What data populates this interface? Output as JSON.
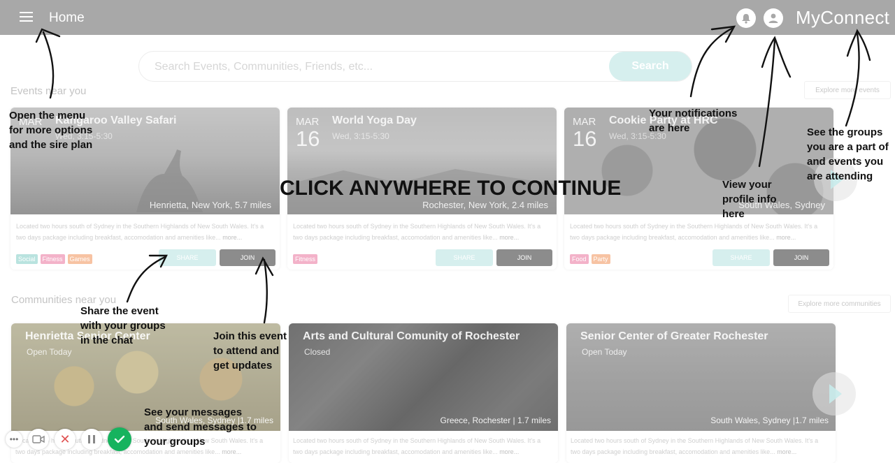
{
  "header": {
    "title": "Home",
    "brand": "MyConnect"
  },
  "search": {
    "placeholder": "Search Events, Communities, Friends, etc...",
    "button": "Search"
  },
  "events_section": {
    "title": "Events near you",
    "explore": "Explore more events",
    "cards": [
      {
        "month": "MAR",
        "day": "",
        "title": "Kangaroo Valley Safari",
        "time": "Wed, 3:15-5:30",
        "location": "Henrietta, New York, 5.7 miles",
        "description": "Located two hours south of Sydney in the Southern Highlands of New South Wales. It's a two days package including breakfast, accomodation and amenities like...",
        "more": "more...",
        "tags": [
          "Social",
          "Fitness",
          "Games"
        ],
        "share": "SHARE",
        "join": "JOIN"
      },
      {
        "month": "MAR",
        "day": "16",
        "title": "World Yoga Day",
        "time": "Wed, 3:15-5:30",
        "location": "Rochester, New York, 2.4 miles",
        "description": "Located two hours south of Sydney in the Southern Highlands of New South Wales. It's a two days package including breakfast, accomodation and amenities like...",
        "more": "more...",
        "tags": [
          "Fitness"
        ],
        "share": "SHARE",
        "join": "JOIN"
      },
      {
        "month": "MAR",
        "day": "16",
        "title": "Cookie Party at HRC",
        "time": "Wed, 3:15-5:30",
        "location": "South Wales, Sydney",
        "description": "Located two hours south of Sydney in the Southern Highlands of New South Wales. It's a two days package including breakfast, accomodation and amenities like...",
        "more": "more...",
        "tags": [
          "Food",
          "Party"
        ],
        "share": "SHARE",
        "join": "JOIN"
      }
    ]
  },
  "communities_section": {
    "title": "Communities near you",
    "explore": "Explore more communities",
    "cards": [
      {
        "title": "Henrietta Senior Center",
        "status": "Open Today",
        "location": "South Wales, Sydney |1.7 miles",
        "description": "Located two hours south of Sydney in the Southern Highlands of New South Wales. It's a two days package including breakfast, accomodation and amenities like...",
        "more": "more..."
      },
      {
        "title": "Arts and Cultural Comunity of Rochester",
        "status": "Closed",
        "location": "Greece, Rochester | 1.7 miles",
        "description": "Located two hours south of Sydney in the Southern Highlands of New South Wales. It's a two days package including breakfast, accomodation and amenities like...",
        "more": "more..."
      },
      {
        "title": "Senior Center of Greater Rochester",
        "status": "Open Today",
        "location": "South Wales, Sydney |1.7 miles",
        "description": "Located two hours south of Sydney in the Southern Highlands of New South Wales. It's a two days package including breakfast, accomodation and amenities like...",
        "more": "more..."
      }
    ]
  },
  "tutorial": {
    "continue": "CLICK ANYWHERE TO CONTINUE",
    "menu_tip": "Open the  menu\nfor more options\nand the sire plan",
    "notif_tip": "Your notifications\nare here",
    "profile_tip": "View your\nprofile info\nhere",
    "groups_tip": "See the groups\nyou are a part of\nand events you\nare attending",
    "share_tip": "Share the event\nwith your groups\nin the chat",
    "join_tip": "Join this event\nto attend and\nget updates",
    "messages_tip": "See your messages\nand send messages to\nyour groups"
  },
  "colors": {
    "header": "#a8a8a8",
    "tag_social": "#b9e3df",
    "tag_fitness": "#f3b2c9",
    "tag_games": "#f7c3a3",
    "tag_food": "#f3b2c9",
    "tag_party": "#f7c3a3",
    "join": "#8c8c8c",
    "share": "#d6efee"
  }
}
